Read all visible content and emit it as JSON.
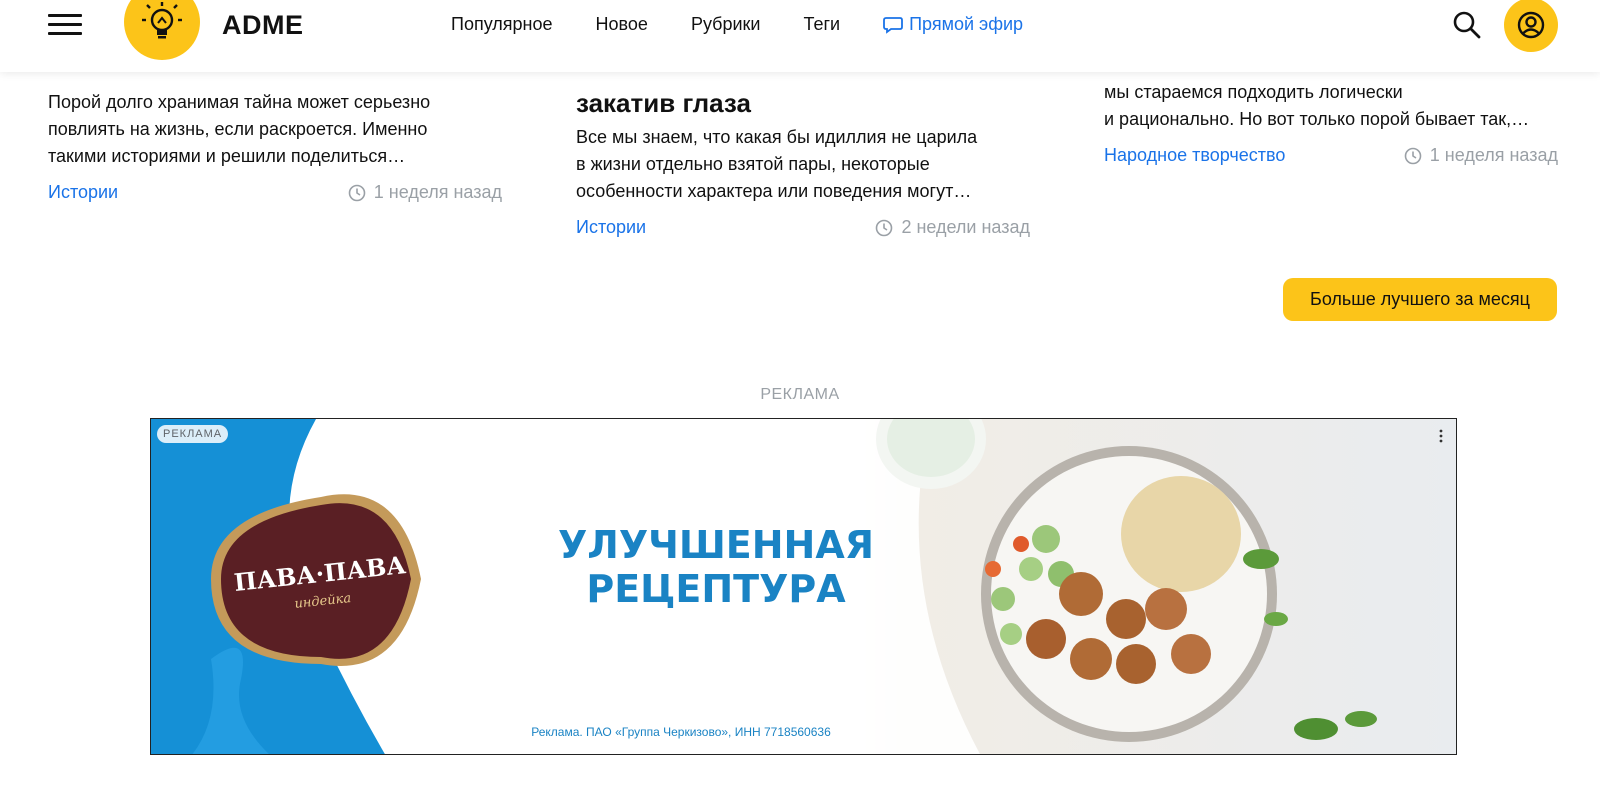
{
  "header": {
    "logo_text": "ADME",
    "nav": [
      "Популярное",
      "Новое",
      "Рубрики",
      "Теги"
    ],
    "live_label": "Прямой эфир"
  },
  "cards": [
    {
      "title_fragment": "",
      "text_lines": [
        "Порой долго хранимая тайна может серьезно",
        "повлиять на жизнь, если раскроется. Именно",
        "такими историями и решили поделиться…"
      ],
      "tag": "Истории",
      "time": "1 неделя назад"
    },
    {
      "title_fragment": "закатив глаза",
      "text_lines": [
        "Все мы знаем, что какая бы идиллия не царила",
        "в жизни отдельно взятой пары, некоторые",
        "особенности характера или поведения могут…"
      ],
      "tag": "Истории",
      "time": "2 недели назад"
    },
    {
      "title_fragment": "",
      "text_lines": [
        "мы стараемся подходить логически",
        "и рационально. Но вот только порой бывает так,…"
      ],
      "tag": "Народное творчество",
      "time": "1 неделя назад"
    }
  ],
  "more_button": "Больше лучшего за месяц",
  "ad": {
    "section_label": "РЕКЛАМА",
    "badge": "РЕКЛАМА",
    "brand_name": "ПАВА·ПАВА",
    "brand_sub": "индейка",
    "headline_1": "УЛУЧШЕННАЯ",
    "headline_2": "РЕЦЕПТУРА",
    "legal": "Реклама. ПАО «Группа Черкизово», ИНН 7718560636"
  },
  "colors": {
    "accent_yellow": "#fcc419",
    "link_blue": "#1a73e8",
    "ad_blue": "#1a83c4"
  }
}
